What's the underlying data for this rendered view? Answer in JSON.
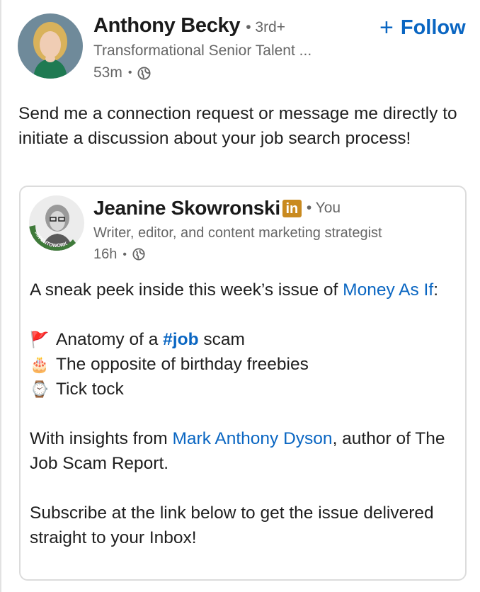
{
  "author": {
    "name": "Anthony Becky",
    "degree": "• 3rd+",
    "headline": "Transformational Senior Talent ...",
    "time": "53m",
    "sep": "•"
  },
  "follow": {
    "plus": "+",
    "label": "Follow"
  },
  "post_text": "Send me a connection request or message me directly to initiate a discussion about your job search process!",
  "shared": {
    "name": "Jeanine Skowronski",
    "badge": "in",
    "relation": "• You",
    "headline": "Writer, editor, and content marketing strategist",
    "time": "16h",
    "sep": "•",
    "avatar_ring_text": "#OPENTOWORK",
    "intro_before": "A sneak peek inside this week’s issue of ",
    "intro_link": "Money As If",
    "intro_after": ":",
    "bullets": [
      {
        "emoji": "🚩",
        "icon": "red-flag-icon",
        "before": "Anatomy of a ",
        "hashtag": "#job",
        "after": " scam"
      },
      {
        "emoji": "🎂",
        "icon": "birthday-cake-icon",
        "before": "The opposite of birthday freebies",
        "hashtag": "",
        "after": ""
      },
      {
        "emoji": "⌚",
        "icon": "watch-icon",
        "before": "Tick tock",
        "hashtag": "",
        "after": ""
      }
    ],
    "insights_before": "With insights from ",
    "insights_link": "Mark Anthony Dyson",
    "insights_after": ", author of The Job Scam Report.",
    "subscribe": "Subscribe at the link below to get the issue delivered straight to your Inbox!"
  },
  "colors": {
    "link": "#0a66c2",
    "badge": "#c98a1f",
    "opentowork": "#3f7a3a"
  }
}
